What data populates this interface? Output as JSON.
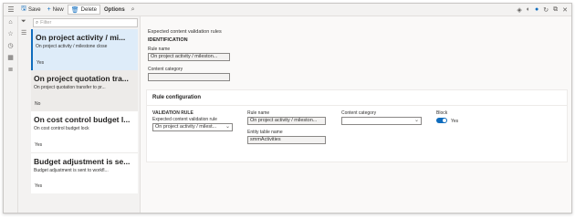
{
  "toolbar": {
    "save_label": "Save",
    "new_label": "New",
    "delete_label": "Delete",
    "options_label": "Options"
  },
  "list": {
    "filter_placeholder": "Filter",
    "items": [
      {
        "title": "On project activity / mi...",
        "description": "On project activity / milestone close",
        "block": "Yes"
      },
      {
        "title": "On project quotation tra...",
        "description": "On project quotation transfer to pr...",
        "block": "No"
      },
      {
        "title": "On cost control budget l...",
        "description": "On cost control budget lock",
        "block": "Yes"
      },
      {
        "title": "Budget adjustment is se...",
        "description": "Budget adjustment is sent to workfl...",
        "block": "Yes"
      }
    ]
  },
  "main": {
    "page_title": "Expected content validation rules",
    "identification_header": "IDENTIFICATION",
    "rule_name_label": "Rule name",
    "rule_name_value": "On project activity / mileston...",
    "content_category_label": "Content category",
    "content_category_value": ""
  },
  "rule_config": {
    "header": "Rule configuration",
    "validation_rule_header": "VALIDATION RULE",
    "expected_rule_label": "Expected content validation rule",
    "expected_rule_value": "On project activity / milest...",
    "rule_name_label": "Rule name",
    "rule_name_value": "On project activity / mileston...",
    "entity_table_label": "Entity table name",
    "entity_table_value": "smmActivities",
    "content_category_label": "Content category",
    "content_category_value": "",
    "block_label": "Block",
    "block_value": "Yes"
  },
  "colors": {
    "accent": "#0f6cbd",
    "selected_bg": "#deecf9"
  }
}
